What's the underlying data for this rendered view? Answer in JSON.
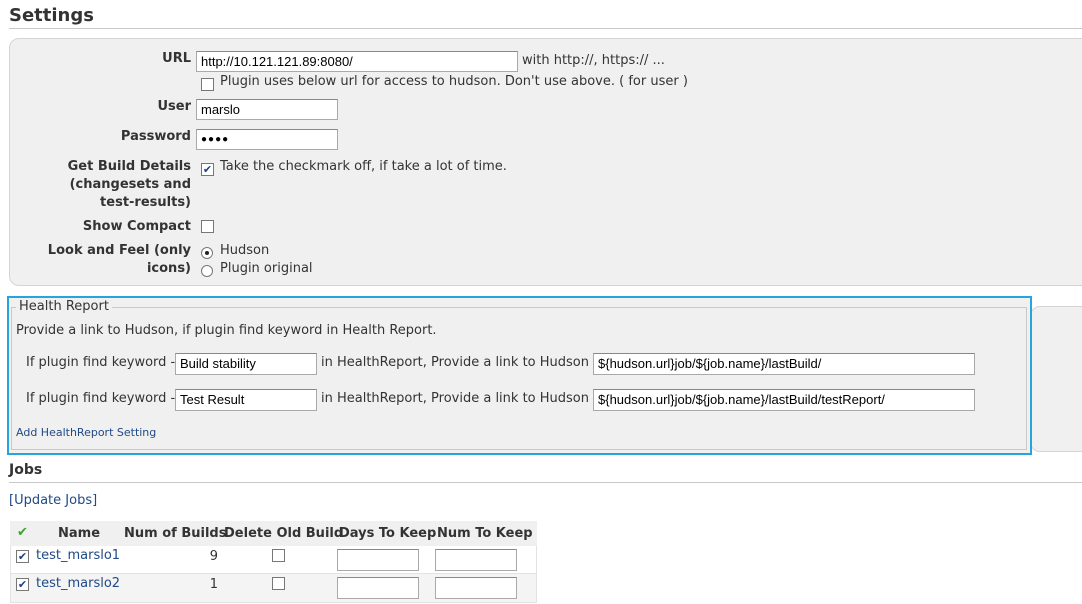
{
  "settings": {
    "title": "Settings",
    "url": {
      "label": "URL",
      "value": "http://10.121.121.89:8080/",
      "hint": "with http://, https:// ...",
      "plugin_url_checkbox_label": "Plugin uses below url for access to hudson. Don't use above. ( for user )"
    },
    "user": {
      "label": "User",
      "value": "marslo"
    },
    "password": {
      "label": "Password",
      "masked": "●●●●"
    },
    "build_details": {
      "label_line1": "Get Build Details",
      "label_line2": "(changesets and",
      "label_line3": "test-results)",
      "checkbox_label": "Take the checkmark off, if take a lot of time.",
      "checked": true
    },
    "show_compact": {
      "label": "Show Compact",
      "checked": false
    },
    "look_and_feel": {
      "label_line1": "Look and Feel (only",
      "label_line2": "icons)",
      "options": [
        "Hudson",
        "Plugin original"
      ],
      "selected": "Hudson"
    }
  },
  "health_report": {
    "legend": "Health Report",
    "description": "Provide a link to Hudson, if plugin find keyword in Health Report.",
    "prefix": "If plugin find keyword -",
    "middle": "in HealthReport, Provide a link to Hudson -",
    "rows": [
      {
        "keyword": "Build stability",
        "link": "${hudson.url}job/${job.name}/lastBuild/"
      },
      {
        "keyword": "Test Result",
        "link": "${hudson.url}job/${job.name}/lastBuild/testReport/"
      }
    ],
    "add_link": "Add HealthReport Setting",
    "highlight_color": "#29a3dc"
  },
  "jobs": {
    "title": "Jobs",
    "update_link": "[Update Jobs]",
    "check_glyph": "✔",
    "columns": [
      "Name",
      "Num of Builds",
      "Delete Old Build",
      "Days To Keep",
      "Num To Keep"
    ],
    "rows": [
      {
        "name": "test_marslo1",
        "builds": "9",
        "enabled": true,
        "delete_old": false,
        "days_to_keep": "",
        "num_to_keep": ""
      },
      {
        "name": "test_marslo2",
        "builds": "1",
        "enabled": true,
        "delete_old": false,
        "days_to_keep": "",
        "num_to_keep": ""
      }
    ]
  }
}
